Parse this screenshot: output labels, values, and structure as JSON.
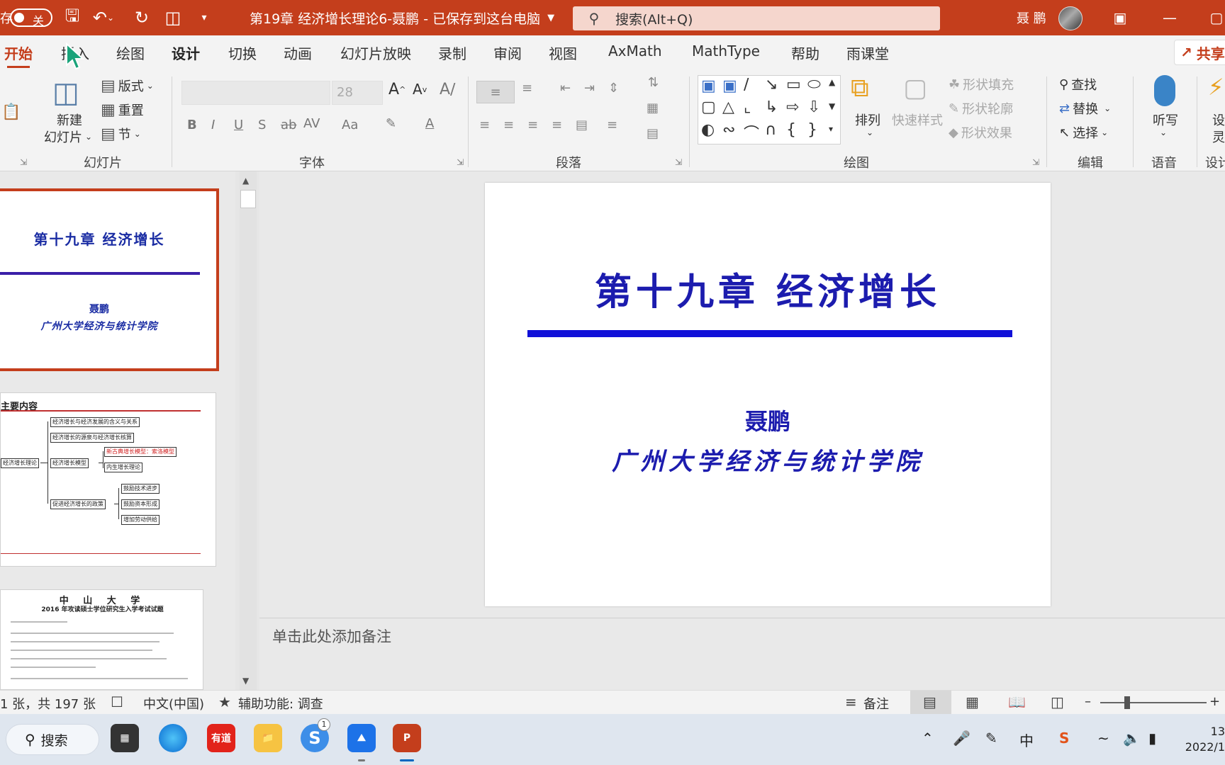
{
  "titlebar": {
    "autosave_label": "存",
    "autosave_toggle": "关",
    "doc_title": "第19章 经济增长理论6-聂鹏 - 已保存到这台电脑",
    "search_placeholder": "搜索(Alt+Q)",
    "user_name": "聂 鹏"
  },
  "tabs": [
    "开始",
    "插入",
    "绘图",
    "设计",
    "切换",
    "动画",
    "幻灯片放映",
    "录制",
    "审阅",
    "视图",
    "AxMath",
    "MathType",
    "帮助",
    "雨课堂"
  ],
  "share_label": "共享",
  "ribbon": {
    "slides": {
      "label": "幻灯片",
      "new_slide_1": "新建",
      "new_slide_2": "幻灯片",
      "layout": "版式",
      "reset": "重置",
      "section": "节"
    },
    "font": {
      "label": "字体",
      "size": "28"
    },
    "paragraph": {
      "label": "段落"
    },
    "drawing": {
      "label": "绘图",
      "arrange": "排列",
      "quick_styles": "快速样式",
      "fill": "形状填充",
      "outline": "形状轮廓",
      "effects": "形状效果"
    },
    "editing": {
      "label": "编辑",
      "find": "查找",
      "replace": "替换",
      "select": "选择"
    },
    "voice": {
      "label": "语音",
      "dictate": "听写"
    },
    "designer": {
      "label": "设计",
      "top": "设",
      "bottom": "灵"
    }
  },
  "thumbnails": {
    "slide1": {
      "title": "第十九章 经济增长",
      "author": "聂鹏",
      "institute": "广州大学经济与统计学院"
    },
    "slide2": {
      "title": "主要内容",
      "root": "经济增长理论",
      "nodes": [
        "经济增长与经济发展的含义与关系",
        "经济增长的源泉与经济增长核算",
        "经济增长模型",
        "促进经济增长的政策"
      ],
      "model_children": [
        "新古典增长模型：索洛模型",
        "内生增长理论"
      ],
      "policy_children": [
        "鼓励技术进步",
        "鼓励资本形成",
        "增加劳动供给"
      ]
    },
    "slide3": {
      "title": "中 山 大 学",
      "subtitle": "2016 年攻读硕士学位研究生入学考试试题"
    }
  },
  "slide": {
    "title": "第十九章 经济增长",
    "author": "聂鹏",
    "institute": "广州大学经济与统计学院",
    "title_color": "#1c1cae",
    "rule_color": "#1010d8"
  },
  "notes_placeholder": "单击此处添加备注",
  "statusbar": {
    "slide_count": "1 张，共 197 张",
    "language": "中文(中国)",
    "accessibility": "辅助功能: 调查",
    "notes": "备注"
  },
  "taskbar": {
    "search_label": "搜索",
    "youdao_label": "有道",
    "badge": "1",
    "ime": "中",
    "clock_time": "13",
    "clock_date": "2022/1"
  },
  "colors": {
    "accent": "#c43e1c",
    "titlebar": "#c43e1c"
  }
}
